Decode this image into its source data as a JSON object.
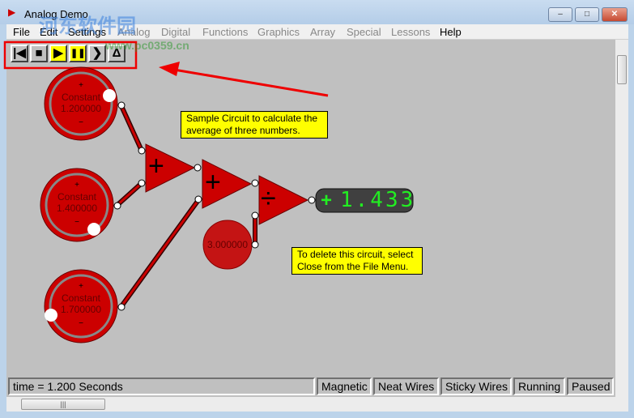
{
  "window": {
    "title": "Analog Demo",
    "minimize": "–",
    "maximize": "□",
    "close": "✕"
  },
  "menu": [
    "File",
    "Edit",
    "Settings",
    "Analog",
    "Digital",
    "Functions",
    "Graphics",
    "Array",
    "Special",
    "Lessons",
    "Help"
  ],
  "toolbar": {
    "buttons": [
      {
        "name": "rewind",
        "glyph": "|◀"
      },
      {
        "name": "stop",
        "glyph": "■"
      },
      {
        "name": "play",
        "glyph": "▶"
      },
      {
        "name": "pause",
        "glyph": "❚❚"
      },
      {
        "name": "step",
        "glyph": "❯"
      },
      {
        "name": "delta",
        "glyph": "Δ"
      }
    ]
  },
  "circuit": {
    "knobs": [
      {
        "label": "Constant",
        "value": "1.200000",
        "plus": "+",
        "minus": "−"
      },
      {
        "label": "Constant",
        "value": "1.400000",
        "plus": "+",
        "minus": "−"
      },
      {
        "label": "Constant",
        "value": "1.700000",
        "plus": "+",
        "minus": "−"
      }
    ],
    "adders": [
      "+",
      "+"
    ],
    "divider": "÷",
    "constant": "3.000000",
    "display": {
      "sign": "+",
      "value": "1.433",
      "color": "#22ee22"
    },
    "notes": [
      "Sample Circuit to calculate the average of three numbers.",
      "To delete this circuit, select Close from the File Menu."
    ],
    "component_color": "#cc0000"
  },
  "status": {
    "time": "time = 1.200 Seconds",
    "cells": [
      "Magnetic",
      "Neat Wires",
      "Sticky Wires",
      "Running",
      "Paused"
    ]
  },
  "watermark": [
    "河东软件园",
    "www.pc0359.cn"
  ]
}
